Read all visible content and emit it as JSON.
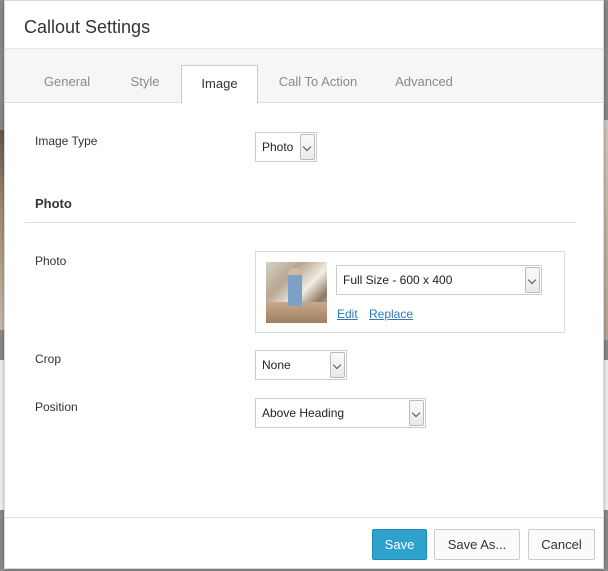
{
  "dialog": {
    "title": "Callout Settings"
  },
  "tabs": [
    {
      "label": "General",
      "active": false
    },
    {
      "label": "Style",
      "active": false
    },
    {
      "label": "Image",
      "active": true
    },
    {
      "label": "Call To Action",
      "active": false
    },
    {
      "label": "Advanced",
      "active": false
    }
  ],
  "fields": {
    "image_type": {
      "label": "Image Type",
      "value": "Photo"
    },
    "section_title": "Photo",
    "photo": {
      "label": "Photo",
      "size_value": "Full Size - 600 x 400",
      "edit_label": "Edit",
      "replace_label": "Replace"
    },
    "crop": {
      "label": "Crop",
      "value": "None"
    },
    "position": {
      "label": "Position",
      "value": "Above Heading"
    }
  },
  "footer": {
    "save_label": "Save",
    "save_as_label": "Save As...",
    "cancel_label": "Cancel"
  },
  "colors": {
    "primary_button": "#2ea2cc",
    "link": "#2e7bb8"
  }
}
